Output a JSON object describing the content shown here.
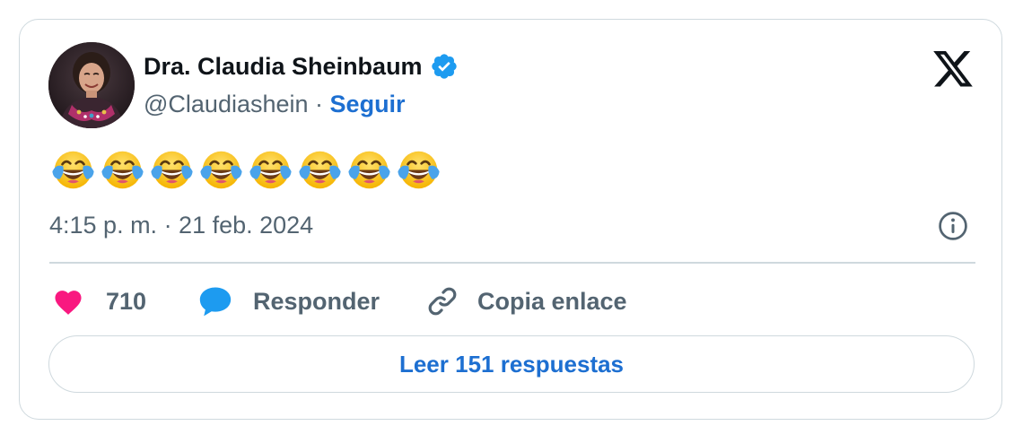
{
  "author": {
    "name": "Dra. Claudia Sheinbaum",
    "handle": "@Claudiashein",
    "separator": "·",
    "follow_label": "Seguir",
    "verified": true
  },
  "tweet": {
    "emoji_count": 8,
    "emoji_name": "face-with-tears-of-joy-icon",
    "timestamp": "4:15 p. m. · 21 feb. 2024"
  },
  "actions": {
    "like_count": "710",
    "reply_label": "Responder",
    "copy_link_label": "Copia enlace"
  },
  "read_replies_label": "Leer 151 respuestas",
  "colors": {
    "link_blue": "#1d6fd1",
    "like_pink": "#f91880",
    "reply_blue": "#1d9bf0",
    "verified_blue": "#1d9bf0",
    "muted_text": "#536471",
    "border": "#cfd9de"
  },
  "icons": {
    "brand": "x-logo-icon",
    "verified": "verified-badge-icon",
    "info": "info-icon",
    "like": "heart-icon",
    "reply": "speech-bubble-icon",
    "copy": "link-icon"
  }
}
